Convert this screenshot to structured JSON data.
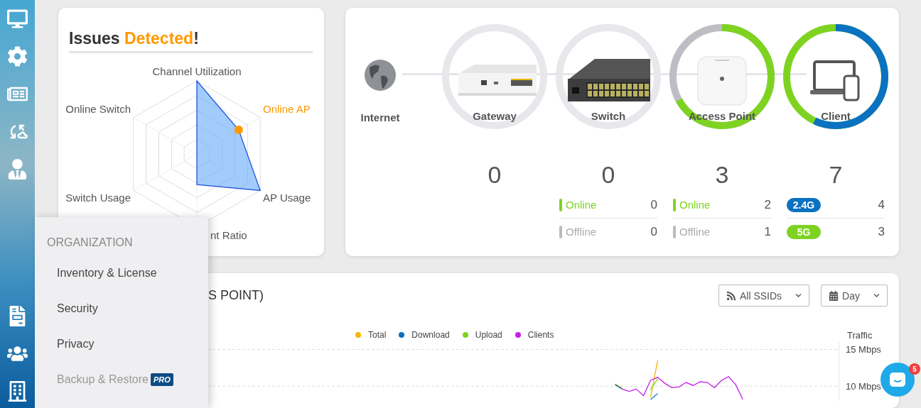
{
  "issues_card": {
    "title": [
      {
        "text": "Issues ",
        "highlight": false
      },
      {
        "text": "Detected",
        "highlight": true
      },
      {
        "text": "!",
        "highlight": false
      }
    ],
    "radar_axes": [
      {
        "label": "Channel Utilization",
        "highlight": false
      },
      {
        "label": "Online AP",
        "highlight": true
      },
      {
        "label": "AP Usage",
        "highlight": false
      },
      {
        "label": "nt Ratio",
        "highlight": false
      },
      {
        "label": "Switch Usage",
        "highlight": false
      },
      {
        "label": "Online Switch",
        "highlight": false
      }
    ]
  },
  "topology": {
    "internet": {
      "label": "Internet"
    },
    "nodes": [
      {
        "kind": "gateway",
        "label": "Gateway",
        "count": "0"
      },
      {
        "kind": "switch",
        "label": "Switch",
        "count": "0",
        "stats": [
          {
            "kind": "status",
            "label": "Online",
            "value": "0",
            "online": true
          },
          {
            "kind": "status",
            "label": "Offline",
            "value": "0",
            "online": false
          }
        ]
      },
      {
        "kind": "access_point",
        "label": "Access Point",
        "count": "3",
        "ring": {
          "level": 0.67
        },
        "stats": [
          {
            "kind": "status",
            "label": "Online",
            "value": "2",
            "online": true
          },
          {
            "kind": "status",
            "label": "Offline",
            "value": "1",
            "online": false
          }
        ]
      },
      {
        "kind": "client",
        "label": "Client",
        "count": "7",
        "ring": {
          "level": 0.57
        },
        "stats": [
          {
            "kind": "band",
            "label": "2.4G",
            "value": "4",
            "color": "#0b72c2"
          },
          {
            "kind": "band",
            "label": "5G",
            "value": "3",
            "color": "#7ed321"
          }
        ]
      }
    ]
  },
  "traffic_card": {
    "title": "S POINT)",
    "filters": [
      {
        "kind": "ssid",
        "label": "All SSIDs"
      },
      {
        "kind": "period",
        "label": "Day"
      }
    ],
    "chart_data": {
      "type": "line",
      "ylabel": "Traffic",
      "ylim": [
        8,
        16
      ],
      "yticks": [
        {
          "value": 10,
          "label": "10 Mbps"
        },
        {
          "value": 15,
          "label": "15 Mbps"
        }
      ],
      "categories": [
        null,
        null,
        null,
        null,
        null,
        null,
        null,
        null,
        null,
        null,
        null,
        null,
        null,
        null,
        null,
        null,
        null,
        null,
        null,
        null,
        null,
        null,
        null,
        null,
        null,
        null,
        null,
        null,
        null,
        null,
        null,
        null,
        null,
        null,
        null,
        null,
        null,
        null,
        null,
        null,
        null,
        null,
        null,
        null,
        null,
        null,
        null,
        null,
        null,
        null,
        null,
        null,
        null,
        null,
        null,
        null,
        null,
        null,
        null,
        null,
        null,
        null,
        null,
        null,
        null,
        null,
        null,
        null,
        null,
        null,
        null,
        null,
        null,
        null,
        null,
        null,
        null,
        null,
        null,
        null,
        null,
        null,
        null,
        null,
        null,
        null,
        null,
        null,
        null,
        null,
        null,
        null,
        null,
        null,
        null,
        null,
        null,
        null,
        null,
        null,
        null,
        null,
        null,
        null,
        null,
        null,
        null,
        null,
        null,
        null
      ],
      "series": [
        {
          "name": "Total",
          "color": "#f7b500",
          "values": [
            null,
            null,
            null,
            null,
            null,
            null,
            null,
            null,
            null,
            null,
            null,
            null,
            null,
            null,
            null,
            null,
            null,
            null,
            null,
            null,
            null,
            null,
            null,
            null,
            null,
            null,
            null,
            null,
            null,
            null,
            null,
            null,
            null,
            null,
            null,
            null,
            null,
            null,
            null,
            null,
            null,
            null,
            null,
            null,
            null,
            null,
            null,
            null,
            null,
            null,
            null,
            null,
            null,
            null,
            null,
            null,
            null,
            null,
            null,
            null,
            null,
            null,
            null,
            null,
            null,
            null,
            null,
            null,
            null,
            null,
            null,
            null,
            null,
            null,
            null,
            null,
            null,
            null,
            10.3,
            9.7,
            null,
            null,
            null,
            8.5,
            13.5,
            null,
            null,
            null,
            null,
            null,
            null,
            null,
            null,
            null,
            null,
            null,
            null,
            null,
            null,
            null,
            null,
            null,
            null,
            null,
            null,
            null,
            null,
            null,
            null,
            null
          ]
        },
        {
          "name": "Download",
          "color": "#0b6fbf",
          "values": [
            null,
            null,
            null,
            null,
            null,
            null,
            null,
            null,
            null,
            null,
            null,
            null,
            null,
            null,
            null,
            null,
            null,
            null,
            null,
            null,
            null,
            null,
            null,
            null,
            null,
            null,
            null,
            null,
            null,
            null,
            null,
            null,
            null,
            null,
            null,
            null,
            null,
            null,
            null,
            null,
            null,
            null,
            null,
            null,
            null,
            null,
            null,
            null,
            null,
            null,
            null,
            null,
            null,
            null,
            null,
            null,
            null,
            null,
            null,
            null,
            null,
            null,
            null,
            null,
            null,
            null,
            null,
            null,
            null,
            null,
            null,
            null,
            null,
            null,
            null,
            null,
            null,
            null,
            10.2,
            9.6,
            null,
            null,
            null,
            8.2,
            9,
            null,
            null,
            null,
            null,
            null,
            null,
            null,
            null,
            null,
            null,
            null,
            null,
            null,
            null,
            null,
            null,
            null,
            null,
            null,
            null,
            null,
            null,
            null,
            null,
            null
          ]
        },
        {
          "name": "Upload",
          "color": "#7ed321",
          "values": [
            null,
            null,
            null,
            null,
            null,
            null,
            null,
            null,
            null,
            null,
            null,
            null,
            null,
            null,
            null,
            null,
            null,
            null,
            null,
            null,
            null,
            null,
            null,
            null,
            null,
            null,
            null,
            null,
            null,
            null,
            null,
            null,
            null,
            null,
            null,
            null,
            null,
            null,
            null,
            null,
            null,
            null,
            null,
            null,
            null,
            null,
            null,
            null,
            null,
            null,
            null,
            null,
            null,
            null,
            null,
            null,
            null,
            null,
            null,
            null,
            null,
            null,
            null,
            null,
            null,
            null,
            null,
            null,
            null,
            null,
            null,
            null,
            null,
            null,
            null,
            null,
            null,
            null,
            null,
            null,
            null,
            null,
            null,
            9.5,
            11,
            null,
            null,
            null,
            null,
            null,
            null,
            null,
            null,
            null,
            null,
            null,
            null,
            null,
            null,
            null,
            null,
            null,
            null,
            null,
            null,
            null,
            null,
            null,
            null,
            null
          ]
        },
        {
          "name": "Clients",
          "color": "#c61fe6",
          "values": [
            null,
            null,
            null,
            null,
            null,
            null,
            null,
            null,
            null,
            null,
            null,
            null,
            null,
            null,
            null,
            null,
            null,
            null,
            null,
            null,
            null,
            null,
            null,
            null,
            null,
            null,
            null,
            null,
            null,
            null,
            null,
            null,
            null,
            null,
            null,
            null,
            null,
            null,
            null,
            null,
            null,
            null,
            null,
            null,
            null,
            null,
            null,
            null,
            null,
            null,
            null,
            null,
            null,
            null,
            null,
            null,
            null,
            null,
            null,
            null,
            null,
            null,
            null,
            null,
            null,
            null,
            null,
            null,
            null,
            null,
            null,
            null,
            null,
            null,
            null,
            null,
            null,
            null,
            null,
            9.6,
            9.3,
            9.6,
            8.7,
            10.8,
            11.2,
            10.4,
            9.8,
            9.9,
            10.5,
            10.1,
            10.6,
            10.5,
            9.8,
            10.8,
            11.3,
            10.2,
            8.2,
            null,
            null,
            null,
            null,
            null,
            null,
            null,
            null,
            null,
            null,
            null,
            null,
            null
          ]
        }
      ]
    }
  },
  "org_menu": {
    "heading": "ORGANIZATION",
    "items": [
      {
        "label": "Inventory & License",
        "disabled": false
      },
      {
        "label": "Security",
        "disabled": false
      },
      {
        "label": "Privacy",
        "disabled": false
      },
      {
        "label": "Backup & Restore",
        "disabled": true,
        "badge": "PRO"
      }
    ]
  },
  "chat": {
    "badge": "5"
  }
}
